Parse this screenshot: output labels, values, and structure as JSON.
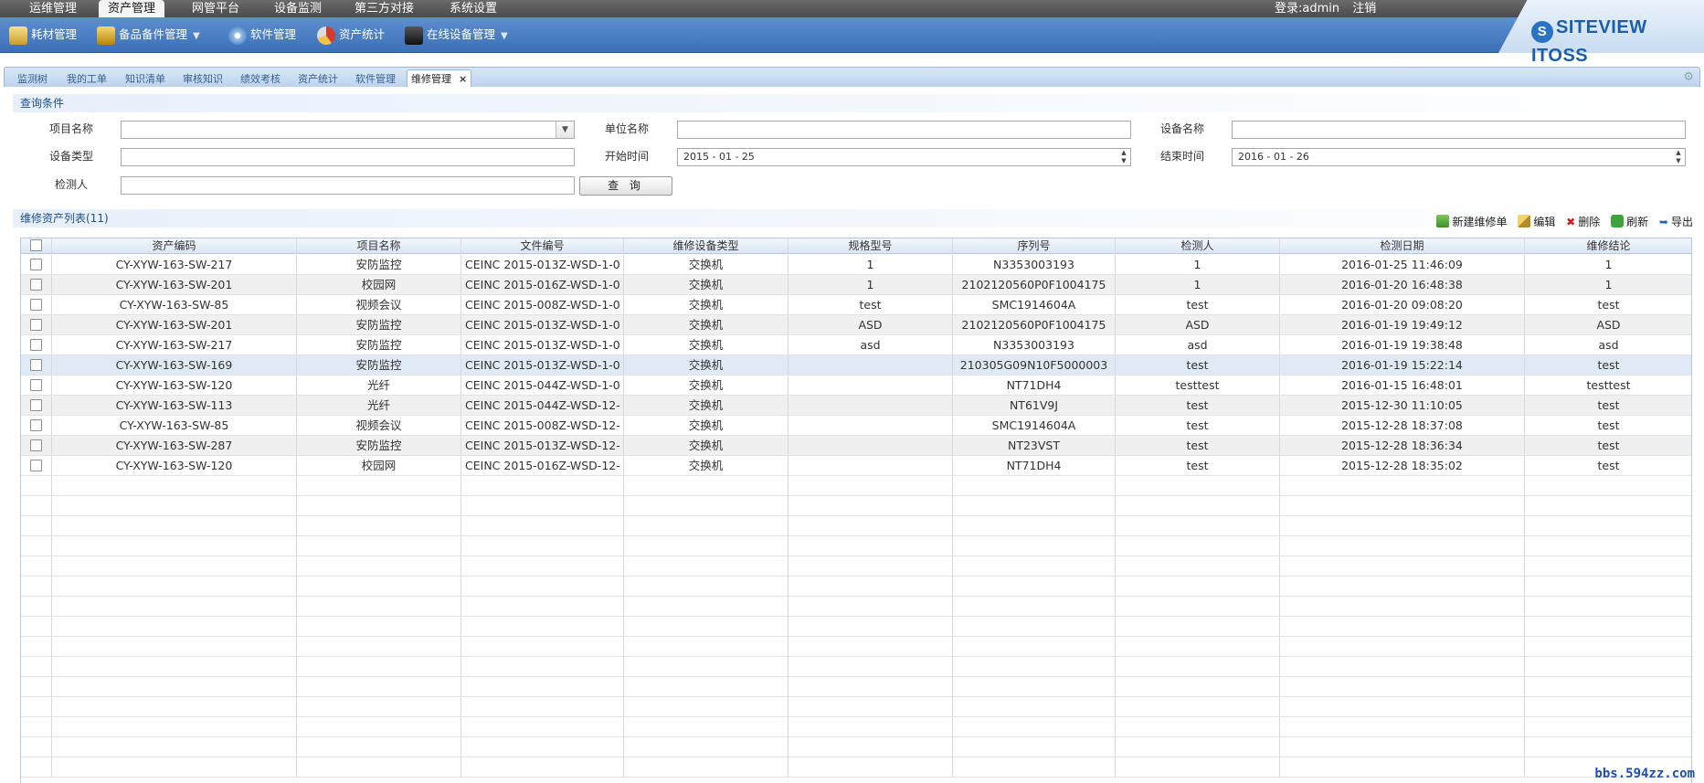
{
  "top_menu": [
    "运维管理",
    "资产管理",
    "网管平台",
    "设备监测",
    "第三方对接",
    "系统设置"
  ],
  "active_menu_index": 1,
  "login": {
    "user_label": "登录:admin",
    "logout_label": "注销"
  },
  "logo": {
    "text": "SITEVIEW ITOSS",
    "mark": "S"
  },
  "toolbar": [
    {
      "label": "耗材管理",
      "icon": "pencil-cup-icon",
      "dropdown": false
    },
    {
      "label": "备品备件管理",
      "icon": "gear-box-icon",
      "dropdown": true
    },
    {
      "label": "软件管理",
      "icon": "cd-icon",
      "dropdown": false
    },
    {
      "label": "资产统计",
      "icon": "pie-chart-icon",
      "dropdown": false
    },
    {
      "label": "在线设备管理",
      "icon": "server-icon",
      "dropdown": true
    }
  ],
  "tabs": [
    "监测树",
    "我的工单",
    "知识清单",
    "审核知识",
    "绩效考核",
    "资产统计",
    "软件管理",
    "维修管理"
  ],
  "active_tab_index": 7,
  "query": {
    "title": "查询条件",
    "project_name_label": "项目名称",
    "unit_name_label": "单位名称",
    "device_name_label": "设备名称",
    "device_type_label": "设备类型",
    "start_time_label": "开始时间",
    "start_time_value": "2015 - 01 - 25",
    "end_time_label": "结束时间",
    "end_time_value": "2016 - 01 - 26",
    "inspector_label": "检测人",
    "search_button": "查 询"
  },
  "list": {
    "title": "维修资产列表(11)",
    "actions": {
      "new": "新建维修单",
      "edit": "编辑",
      "delete": "删除",
      "refresh": "刷新",
      "export": "导出"
    },
    "columns": [
      "资产编码",
      "项目名称",
      "文件编号",
      "维修设备类型",
      "规格型号",
      "序列号",
      "检测人",
      "检测日期",
      "维修结论"
    ],
    "rows": [
      [
        "CY-XYW-163-SW-217",
        "安防监控",
        "CEINC 2015-013Z-WSD-1-0",
        "交换机",
        "1",
        "N3353003193",
        "1",
        "2016-01-25 11:46:09",
        "1"
      ],
      [
        "CY-XYW-163-SW-201",
        "校园网",
        "CEINC 2015-016Z-WSD-1-0",
        "交换机",
        "1",
        "2102120560P0F1004175",
        "1",
        "2016-01-20 16:48:38",
        "1"
      ],
      [
        "CY-XYW-163-SW-85",
        "视频会议",
        "CEINC 2015-008Z-WSD-1-0",
        "交换机",
        "test",
        "SMC1914604A",
        "test",
        "2016-01-20 09:08:20",
        "test"
      ],
      [
        "CY-XYW-163-SW-201",
        "安防监控",
        "CEINC 2015-013Z-WSD-1-0",
        "交换机",
        "ASD",
        "2102120560P0F1004175",
        "ASD",
        "2016-01-19 19:49:12",
        "ASD"
      ],
      [
        "CY-XYW-163-SW-217",
        "安防监控",
        "CEINC 2015-013Z-WSD-1-0",
        "交换机",
        "asd",
        "N3353003193",
        "asd",
        "2016-01-19 19:38:48",
        "asd"
      ],
      [
        "CY-XYW-163-SW-169",
        "安防监控",
        "CEINC 2015-013Z-WSD-1-0",
        "交换机",
        "",
        "210305G09N10F5000003",
        "test",
        "2016-01-19 15:22:14",
        "test"
      ],
      [
        "CY-XYW-163-SW-120",
        "光纤",
        "CEINC 2015-044Z-WSD-1-0",
        "交换机",
        "",
        "NT71DH4",
        "testtest",
        "2016-01-15 16:48:01",
        "testtest"
      ],
      [
        "CY-XYW-163-SW-113",
        "光纤",
        "CEINC 2015-044Z-WSD-12-",
        "交换机",
        "",
        "NT61V9J",
        "test",
        "2015-12-30 11:10:05",
        "test"
      ],
      [
        "CY-XYW-163-SW-85",
        "视频会议",
        "CEINC 2015-008Z-WSD-12-",
        "交换机",
        "",
        "SMC1914604A",
        "test",
        "2015-12-28 18:37:08",
        "test"
      ],
      [
        "CY-XYW-163-SW-287",
        "安防监控",
        "CEINC 2015-013Z-WSD-12-",
        "交换机",
        "",
        "NT23VST",
        "test",
        "2015-12-28 18:36:34",
        "test"
      ],
      [
        "CY-XYW-163-SW-120",
        "校园网",
        "CEINC 2015-016Z-WSD-12-",
        "交换机",
        "",
        "NT71DH4",
        "test",
        "2015-12-28 18:35:02",
        "test"
      ]
    ],
    "selected_row_index": 5
  },
  "watermark": "bbs.594zz.com",
  "colors": {
    "toolbar_blue": "#4a7cc2",
    "selected_row": "#dfeaf6",
    "heading_blue": "#1d4f8a"
  }
}
